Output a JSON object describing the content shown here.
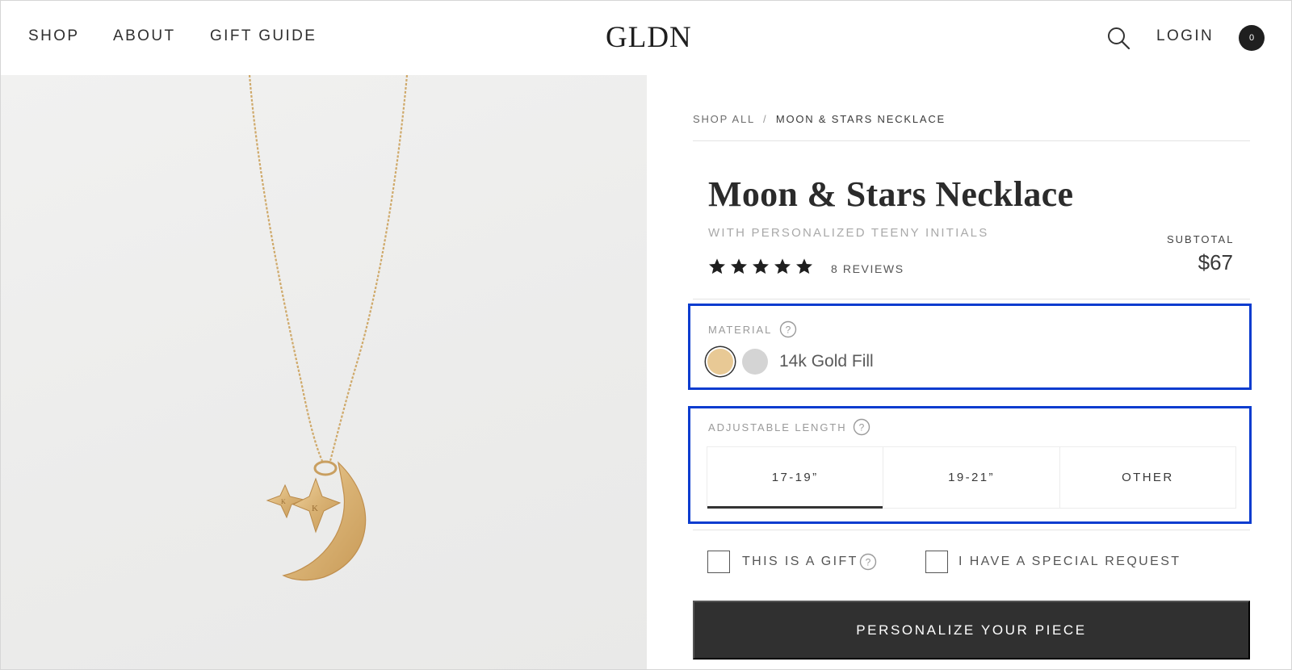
{
  "header": {
    "nav": [
      "SHOP",
      "ABOUT",
      "GIFT GUIDE"
    ],
    "logo": "GLDN",
    "login": "LOGIN",
    "cart_count": "0"
  },
  "breadcrumb": {
    "parent": "SHOP ALL",
    "separator": "/",
    "current": "MOON & STARS NECKLACE"
  },
  "product": {
    "title": "Moon & Stars Necklace",
    "subtitle": "WITH PERSONALIZED TEENY INITIALS",
    "rating": 5,
    "rating_max": 5,
    "reviews": "8 REVIEWS",
    "subtotal_label": "SUBTOTAL",
    "price": "$67"
  },
  "material": {
    "label": "MATERIAL",
    "swatches": [
      {
        "name": "14k Gold Fill",
        "color": "#e8c995",
        "selected": true
      },
      {
        "name": "Sterling Silver",
        "color": "#d4d4d4",
        "selected": false
      }
    ],
    "selected_value": "14k Gold Fill"
  },
  "length": {
    "label": "ADJUSTABLE LENGTH",
    "options": [
      "17-19”",
      "19-21”",
      "OTHER"
    ],
    "selected_index": 0
  },
  "options": {
    "gift": "THIS IS A GIFT",
    "special_request": "I HAVE A SPECIAL REQUEST"
  },
  "cta": "PERSONALIZE YOUR PIECE",
  "colors": {
    "highlight_border": "#0b3ccf",
    "cta_background": "#303030",
    "gold": "#e8c995"
  }
}
